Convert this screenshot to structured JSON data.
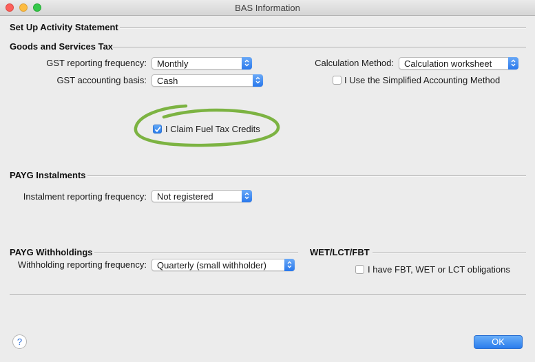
{
  "window": {
    "title": "BAS Information"
  },
  "sections": {
    "setup": "Set Up Activity Statement",
    "gst": "Goods and Services Tax",
    "payg_instalments": "PAYG Instalments",
    "payg_withholdings": "PAYG Withholdings",
    "wet_lct_fbt": "WET/LCT/FBT"
  },
  "gst": {
    "reporting_frequency_label": "GST reporting frequency:",
    "reporting_frequency_value": "Monthly",
    "accounting_basis_label": "GST accounting basis:",
    "accounting_basis_value": "Cash",
    "calculation_method_label": "Calculation Method:",
    "calculation_method_value": "Calculation worksheet",
    "simplified_method_label": "I Use the Simplified Accounting Method",
    "simplified_method_checked": false,
    "fuel_tax_label": "I Claim Fuel Tax Credits",
    "fuel_tax_checked": true
  },
  "payg_instalments": {
    "frequency_label": "Instalment reporting frequency:",
    "frequency_value": "Not registered"
  },
  "payg_withholdings": {
    "frequency_label": "Withholding reporting frequency:",
    "frequency_value": "Quarterly (small withholder)"
  },
  "wet": {
    "obligations_label": "I have FBT, WET or LCT obligations",
    "obligations_checked": false
  },
  "footer": {
    "help_label": "?",
    "ok_label": "OK"
  },
  "colors": {
    "accent": "#2b7ded",
    "highlight": "#7cb342"
  }
}
